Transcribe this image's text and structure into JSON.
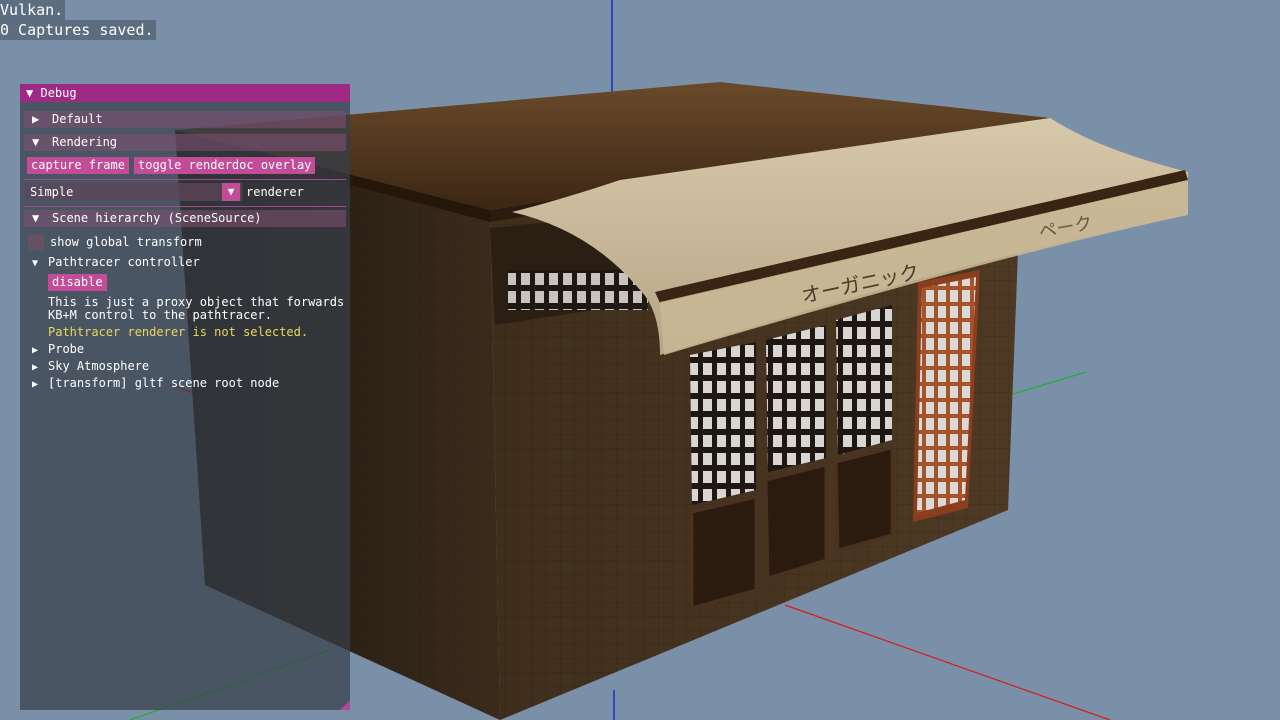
{
  "overlay": {
    "line1": "Vulkan.",
    "line2": "0 Captures saved."
  },
  "debug_window": {
    "title": "Debug",
    "sections": {
      "default": "Default",
      "rendering": "Rendering",
      "scene_hierarchy": "Scene hierarchy (SceneSource)"
    },
    "buttons": {
      "capture_frame": "capture frame",
      "toggle_renderdoc": "toggle renderdoc overlay",
      "disable": "disable"
    },
    "renderer_combo": {
      "selected": "Simple",
      "label": "renderer"
    },
    "checkbox_label": "show global transform",
    "tree": {
      "pathtracer_controller": "Pathtracer controller",
      "description": "This is just a proxy object that forwards\nKB+M control to the pathtracer.",
      "warning": "Pathtracer renderer is not selected.",
      "probe": "Probe",
      "sky_atmosphere": "Sky Atmosphere",
      "gltf_root": "[transform] gltf scene root node"
    }
  },
  "scene": {
    "awning_sign_text": "オーガニック",
    "awning_side_text": "ペーク"
  },
  "colors": {
    "background": "#7a90a8",
    "accent": "#c24c98",
    "title_bar": "#9e2a86",
    "warning": "#e9d85a"
  }
}
